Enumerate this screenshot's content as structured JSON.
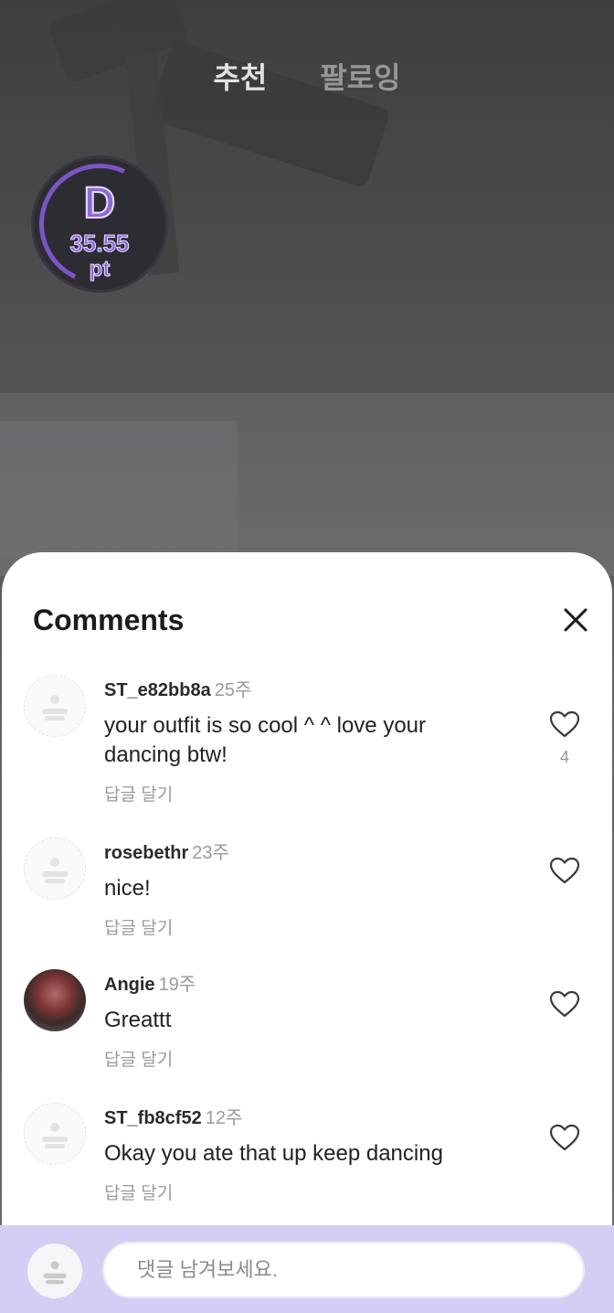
{
  "top_tabs": [
    {
      "label": "추천",
      "active": true
    },
    {
      "label": "팔로잉",
      "active": false
    }
  ],
  "score": {
    "grade": "D",
    "value": "35.55",
    "unit": "pt",
    "color": "#8b6ad6"
  },
  "comments_sheet": {
    "title": "Comments",
    "close_icon": "close-icon",
    "comments": [
      {
        "user": "ST_e82bb8a",
        "time": "25주",
        "text": "your outfit is so cool ^ ^ love your dancing btw!",
        "reply_label": "답글 달기",
        "likes": "4",
        "avatar": "default-avatar-icon"
      },
      {
        "user": "rosebethr",
        "time": "23주",
        "text": "nice!",
        "reply_label": "답글 달기",
        "likes": "",
        "avatar": "default-avatar-icon"
      },
      {
        "user": "Angie",
        "time": "19주",
        "text": "Greattt",
        "reply_label": "답글 달기",
        "likes": "",
        "avatar": "photo"
      },
      {
        "user": "ST_fb8cf52",
        "time": "12주",
        "text": "Okay you ate that up keep dancing",
        "reply_label": "답글 달기",
        "likes": "",
        "avatar": "default-avatar-icon"
      }
    ]
  },
  "input_bar": {
    "placeholder": "댓글 남겨보세요.",
    "value": "",
    "background": "#d6cdf5"
  }
}
